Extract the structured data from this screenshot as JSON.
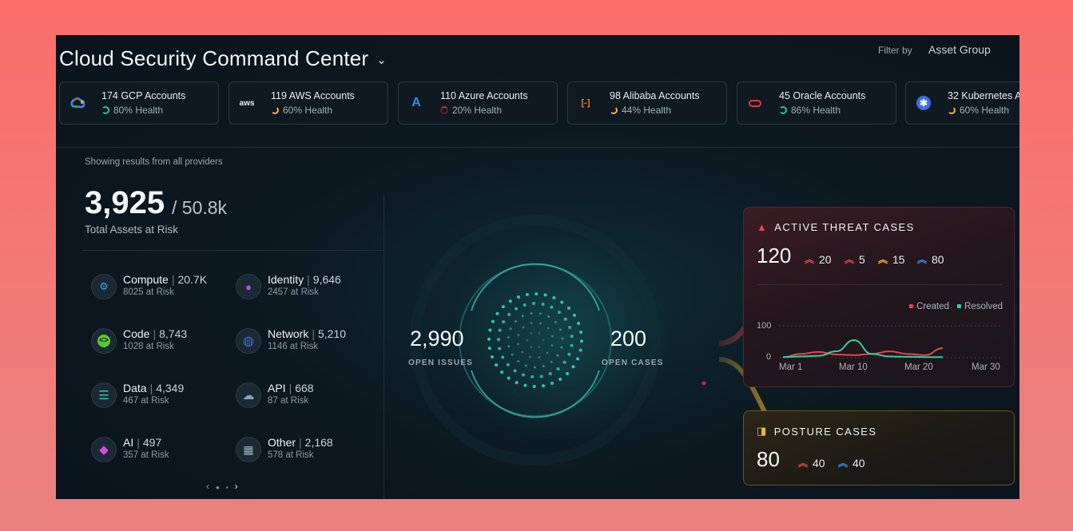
{
  "header": {
    "title": "Cloud Security Command Center",
    "filter_label": "Filter by",
    "filter_value": "Asset Group"
  },
  "accounts": [
    {
      "name": "174 GCP Accounts",
      "health": "80% Health",
      "icon": "gcp-icon",
      "ring_color": "#23c3a3"
    },
    {
      "name": "119 AWS Accounts",
      "health": "60% Health",
      "icon": "aws-icon",
      "ring_color": "#f2b63c"
    },
    {
      "name": "110 Azure Accounts",
      "health": "20% Health",
      "icon": "azure-icon",
      "ring_color": "#b0283a"
    },
    {
      "name": "98 Alibaba Accounts",
      "health": "44% Health",
      "icon": "alibaba-icon",
      "ring_color": "#f2b63c"
    },
    {
      "name": "45 Oracle Accounts",
      "health": "86% Health",
      "icon": "oracle-icon",
      "ring_color": "#23c3a3"
    },
    {
      "name": "32 Kubernetes A",
      "health": "60% Health",
      "icon": "kubernetes-icon",
      "ring_color": "#f2b63c"
    }
  ],
  "summary": {
    "showing": "Showing results from all providers",
    "total": "3,925",
    "of": "/ 50.8k",
    "caption": "Total Assets at Risk"
  },
  "assets": [
    {
      "label": "Compute",
      "count": "20.7K",
      "risk": "8025 at Risk",
      "icon": "cpu-icon"
    },
    {
      "label": "Identity",
      "count": "9,646",
      "risk": "2457 at Risk",
      "icon": "user-icon"
    },
    {
      "label": "Code",
      "count": "8,743",
      "risk": "1028 at Risk",
      "icon": "code-icon"
    },
    {
      "label": "Network",
      "count": "5,210",
      "risk": "1146 at Risk",
      "icon": "globe-icon"
    },
    {
      "label": "Data",
      "count": "4,349",
      "risk": "467 at Risk",
      "icon": "database-icon"
    },
    {
      "label": "API",
      "count": "668",
      "risk": "87 at Risk",
      "icon": "api-cloud-icon"
    },
    {
      "label": "AI",
      "count": "497",
      "risk": "357 at Risk",
      "icon": "sparkle-icon"
    },
    {
      "label": "Other",
      "count": "2,168",
      "risk": "578 at Risk",
      "icon": "grid-icon"
    }
  ],
  "pager": {
    "prev": "‹",
    "next": "›"
  },
  "center": {
    "open_issues": "2,990",
    "open_issues_label": "OPEN ISSUES",
    "open_cases": "200",
    "open_cases_label": "OPEN CASES"
  },
  "threat": {
    "title": "ACTIVE THREAT CASES",
    "total": "120",
    "severities": [
      {
        "value": "20",
        "color": "#e8434f",
        "icon": "double-chevron-up-icon"
      },
      {
        "value": "5",
        "color": "#e8434f",
        "icon": "double-chevron-up-icon"
      },
      {
        "value": "15",
        "color": "#f2b63c",
        "icon": "double-chevron-up-icon"
      },
      {
        "value": "80",
        "color": "#3b8be8",
        "icon": "double-chevron-up-icon"
      }
    ]
  },
  "posture": {
    "title": "POSTURE CASES",
    "total": "80",
    "severities": [
      {
        "value": "40",
        "color": "#e8434f",
        "icon": "double-chevron-up-icon"
      },
      {
        "value": "40",
        "color": "#3b8be8",
        "icon": "double-chevron-up-icon"
      }
    ]
  },
  "chart_data": {
    "type": "line",
    "x": [
      "Mar 1",
      "Mar 4",
      "Mar 7",
      "Mar 9",
      "Mar 10",
      "Mar 11",
      "Mar 13",
      "Mar 16",
      "Mar 20",
      "Mar 23"
    ],
    "x_ticks": [
      "Mar 1",
      "Mar 10",
      "Mar 20",
      "Mar 30"
    ],
    "y_ticks": [
      "100",
      "0"
    ],
    "ylim": [
      0,
      100
    ],
    "series": [
      {
        "name": "Created",
        "color": "#e8434f",
        "values": [
          2,
          12,
          18,
          10,
          8,
          12,
          20,
          12,
          8,
          30
        ]
      },
      {
        "name": "Resolved",
        "color": "#2fd0a5",
        "values": [
          2,
          4,
          6,
          20,
          55,
          12,
          4,
          3,
          2,
          2
        ]
      }
    ],
    "grid": true,
    "legend": "top-right"
  },
  "colors": {
    "accent": "#2fd0a5",
    "threat": "#e8434f",
    "posture": "#f2b63c"
  }
}
